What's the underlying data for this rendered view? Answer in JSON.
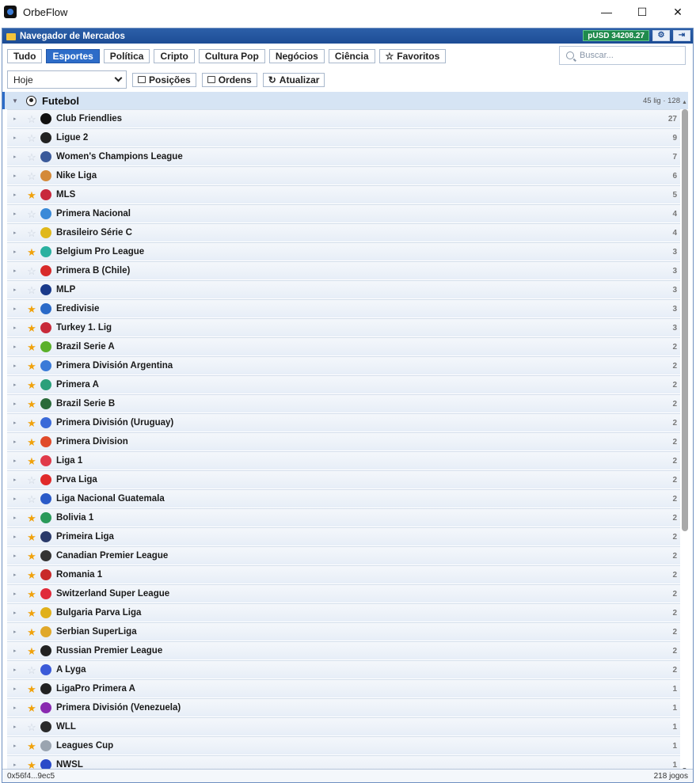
{
  "window": {
    "title": "OrbeFlow",
    "minimize": "—",
    "maximize": "☐",
    "close": "✕"
  },
  "panel": {
    "title": "Navegador de Mercados",
    "balance": "pUSD 34208.27"
  },
  "tabs": [
    "Tudo",
    "Esportes",
    "Política",
    "Cripto",
    "Cultura Pop",
    "Negócios",
    "Ciência",
    "Favoritos"
  ],
  "active_tab": "Esportes",
  "search": {
    "placeholder": "Buscar..."
  },
  "toolbar": {
    "date_select": "Hoje",
    "positions": "Posições",
    "orders": "Ordens",
    "refresh": "Atualizar"
  },
  "sport": {
    "name": "Futebol",
    "meta": "45 lig · 128"
  },
  "leagues": [
    {
      "name": "Club Friendlies",
      "count": "27",
      "fav": false,
      "color": "#111"
    },
    {
      "name": "Ligue 2",
      "count": "9",
      "fav": false,
      "color": "#222"
    },
    {
      "name": "Women's Champions League",
      "count": "7",
      "fav": false,
      "color": "#3a5a9a"
    },
    {
      "name": "Nike Liga",
      "count": "6",
      "fav": false,
      "color": "#d48a3a"
    },
    {
      "name": "MLS",
      "count": "5",
      "fav": true,
      "color": "#c8283c"
    },
    {
      "name": "Primera Nacional",
      "count": "4",
      "fav": false,
      "color": "#3a8ad8"
    },
    {
      "name": "Brasileiro Série C",
      "count": "4",
      "fav": false,
      "color": "#e0b81a"
    },
    {
      "name": "Belgium Pro League",
      "count": "3",
      "fav": true,
      "color": "#2ab0a0"
    },
    {
      "name": "Primera B (Chile)",
      "count": "3",
      "fav": false,
      "color": "#d82a2a"
    },
    {
      "name": "MLP",
      "count": "3",
      "fav": false,
      "color": "#1a3a8a"
    },
    {
      "name": "Eredivisie",
      "count": "3",
      "fav": true,
      "color": "#2a6ac8"
    },
    {
      "name": "Turkey 1. Lig",
      "count": "3",
      "fav": true,
      "color": "#c82a3a"
    },
    {
      "name": "Brazil Serie A",
      "count": "2",
      "fav": true,
      "color": "#5ab02a"
    },
    {
      "name": "Primera División Argentina",
      "count": "2",
      "fav": true,
      "color": "#3a7ad8"
    },
    {
      "name": "Primera A",
      "count": "2",
      "fav": true,
      "color": "#2aa07a"
    },
    {
      "name": "Brazil Serie B",
      "count": "2",
      "fav": true,
      "color": "#2a6a3a"
    },
    {
      "name": "Primera División (Uruguay)",
      "count": "2",
      "fav": true,
      "color": "#3a6ad8"
    },
    {
      "name": "Primera Division",
      "count": "2",
      "fav": true,
      "color": "#e04a2a"
    },
    {
      "name": "Liga 1",
      "count": "2",
      "fav": true,
      "color": "#e03a4a"
    },
    {
      "name": "Prva Liga",
      "count": "2",
      "fav": false,
      "color": "#e02a2a"
    },
    {
      "name": "Liga Nacional Guatemala",
      "count": "2",
      "fav": false,
      "color": "#2a5ac8"
    },
    {
      "name": "Bolivia 1",
      "count": "2",
      "fav": true,
      "color": "#2a9a5a"
    },
    {
      "name": "Primeira Liga",
      "count": "2",
      "fav": true,
      "color": "#2a3a6a"
    },
    {
      "name": "Canadian Premier League",
      "count": "2",
      "fav": true,
      "color": "#333"
    },
    {
      "name": "Romania 1",
      "count": "2",
      "fav": true,
      "color": "#c82a2a"
    },
    {
      "name": "Switzerland Super League",
      "count": "2",
      "fav": true,
      "color": "#e02a3a"
    },
    {
      "name": "Bulgaria Parva Liga",
      "count": "2",
      "fav": true,
      "color": "#e0b01a"
    },
    {
      "name": "Serbian SuperLiga",
      "count": "2",
      "fav": true,
      "color": "#e0a82a"
    },
    {
      "name": "Russian Premier League",
      "count": "2",
      "fav": true,
      "color": "#222"
    },
    {
      "name": "A Lyga",
      "count": "2",
      "fav": false,
      "color": "#3a5ad8"
    },
    {
      "name": "LigaPro Primera A",
      "count": "1",
      "fav": true,
      "color": "#222"
    },
    {
      "name": "Primera División (Venezuela)",
      "count": "1",
      "fav": true,
      "color": "#8a2ab0"
    },
    {
      "name": "WLL",
      "count": "1",
      "fav": false,
      "color": "#2a2a2a"
    },
    {
      "name": "Leagues Cup",
      "count": "1",
      "fav": true,
      "color": "#9aa4b0"
    },
    {
      "name": "NWSL",
      "count": "1",
      "fav": true,
      "color": "#2a4ac8"
    }
  ],
  "footer": {
    "address": "0x56f4...9ec5",
    "games": "218 jogos"
  }
}
